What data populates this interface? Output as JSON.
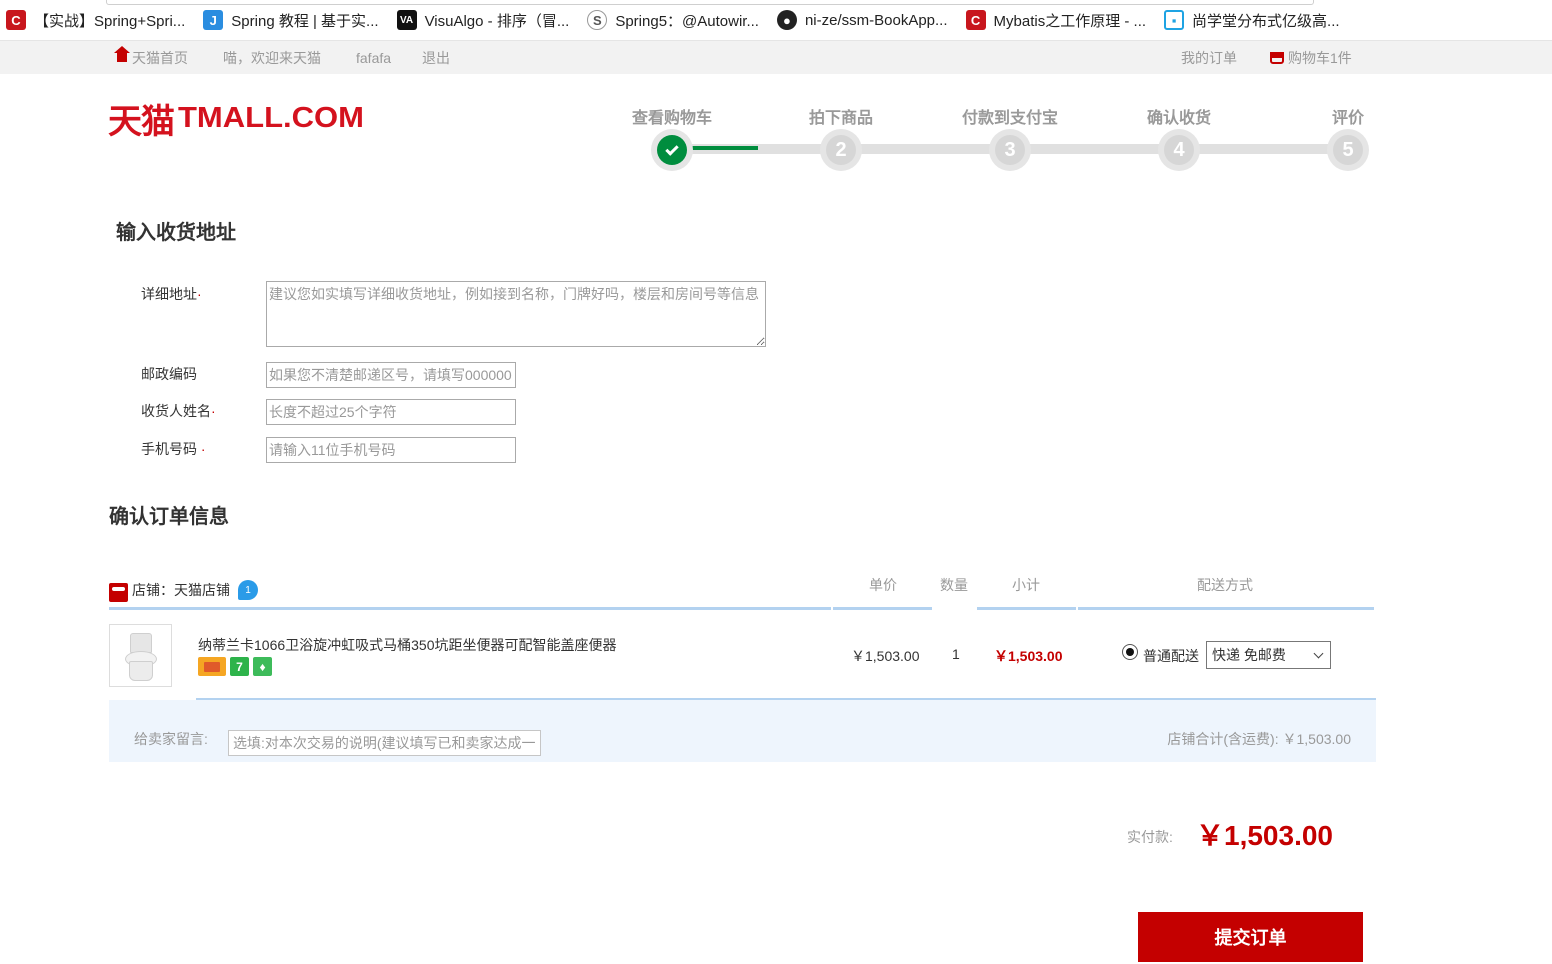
{
  "bookmarks": [
    {
      "icon": "csdn-icon",
      "label": "【实战】Spring+Spri..."
    },
    {
      "icon": "jianshu-icon",
      "label": "Spring 教程 | 基于实..."
    },
    {
      "icon": "visualgo-icon",
      "label": "VisuAlgo - 排序（冒..."
    },
    {
      "icon": "spring-icon",
      "label": "Spring5：@Autowir..."
    },
    {
      "icon": "github-icon",
      "label": "ni-ze/ssm-BookApp..."
    },
    {
      "icon": "csdn-icon",
      "label": "Mybatis之工作原理 - ..."
    },
    {
      "icon": "bilibili-icon",
      "label": "尚学堂分布式亿级高..."
    }
  ],
  "topnav": {
    "home": "天猫首页",
    "welcome": "喵，欢迎来天猫",
    "username": "fafafa",
    "logout": "退出",
    "my_orders": "我的订单",
    "cart": "购物车1件"
  },
  "logo": {
    "cn": "天猫",
    "en": "TMALL.COM"
  },
  "steps": {
    "labels": [
      "查看购物车",
      "拍下商品",
      "付款到支付宝",
      "确认收货",
      "评价"
    ],
    "numbers": [
      "2",
      "3",
      "4",
      "5"
    ],
    "completed": 1
  },
  "address": {
    "title": "输入收货地址",
    "detail_label": "详细地址",
    "detail_placeholder": "建议您如实填写详细收货地址，例如接到名称，门牌好吗，楼层和房间号等信息",
    "post_label": "邮政编码",
    "post_placeholder": "如果您不清楚邮递区号，请填写000000",
    "name_label": "收货人姓名",
    "name_placeholder": "长度不超过25个字符",
    "phone_label": "手机号码",
    "phone_placeholder": "请输入11位手机号码",
    "required_mark": "·"
  },
  "order": {
    "title": "确认订单信息",
    "shop_label": "店铺：天猫店铺",
    "ww_icon_text": "1",
    "columns": {
      "unit_price": "单价",
      "quantity": "数量",
      "subtotal": "小计",
      "delivery": "配送方式"
    },
    "item": {
      "name": "纳蒂兰卡1066卫浴旋冲虹吸式马桶350坑距坐便器可配智能盖座便器",
      "badge_2": "7",
      "unit_price": "￥1,503.00",
      "quantity": "1",
      "subtotal": "￥1,503.00"
    },
    "delivery_option": "普通配送",
    "delivery_select": "快递 免邮费",
    "message_label": "给卖家留言:",
    "message_placeholder": "选填:对本次交易的说明(建议填写已和卖家达成一致的说明)",
    "shop_total": "店铺合计(含运费): ￥1,503.00"
  },
  "payment": {
    "label": "实付款:",
    "amount": "￥1,503.00",
    "submit": "提交订单"
  },
  "colors": {
    "brand_red": "#c40000",
    "step_green": "#008d3e",
    "line_blue": "#b3d2f0"
  }
}
